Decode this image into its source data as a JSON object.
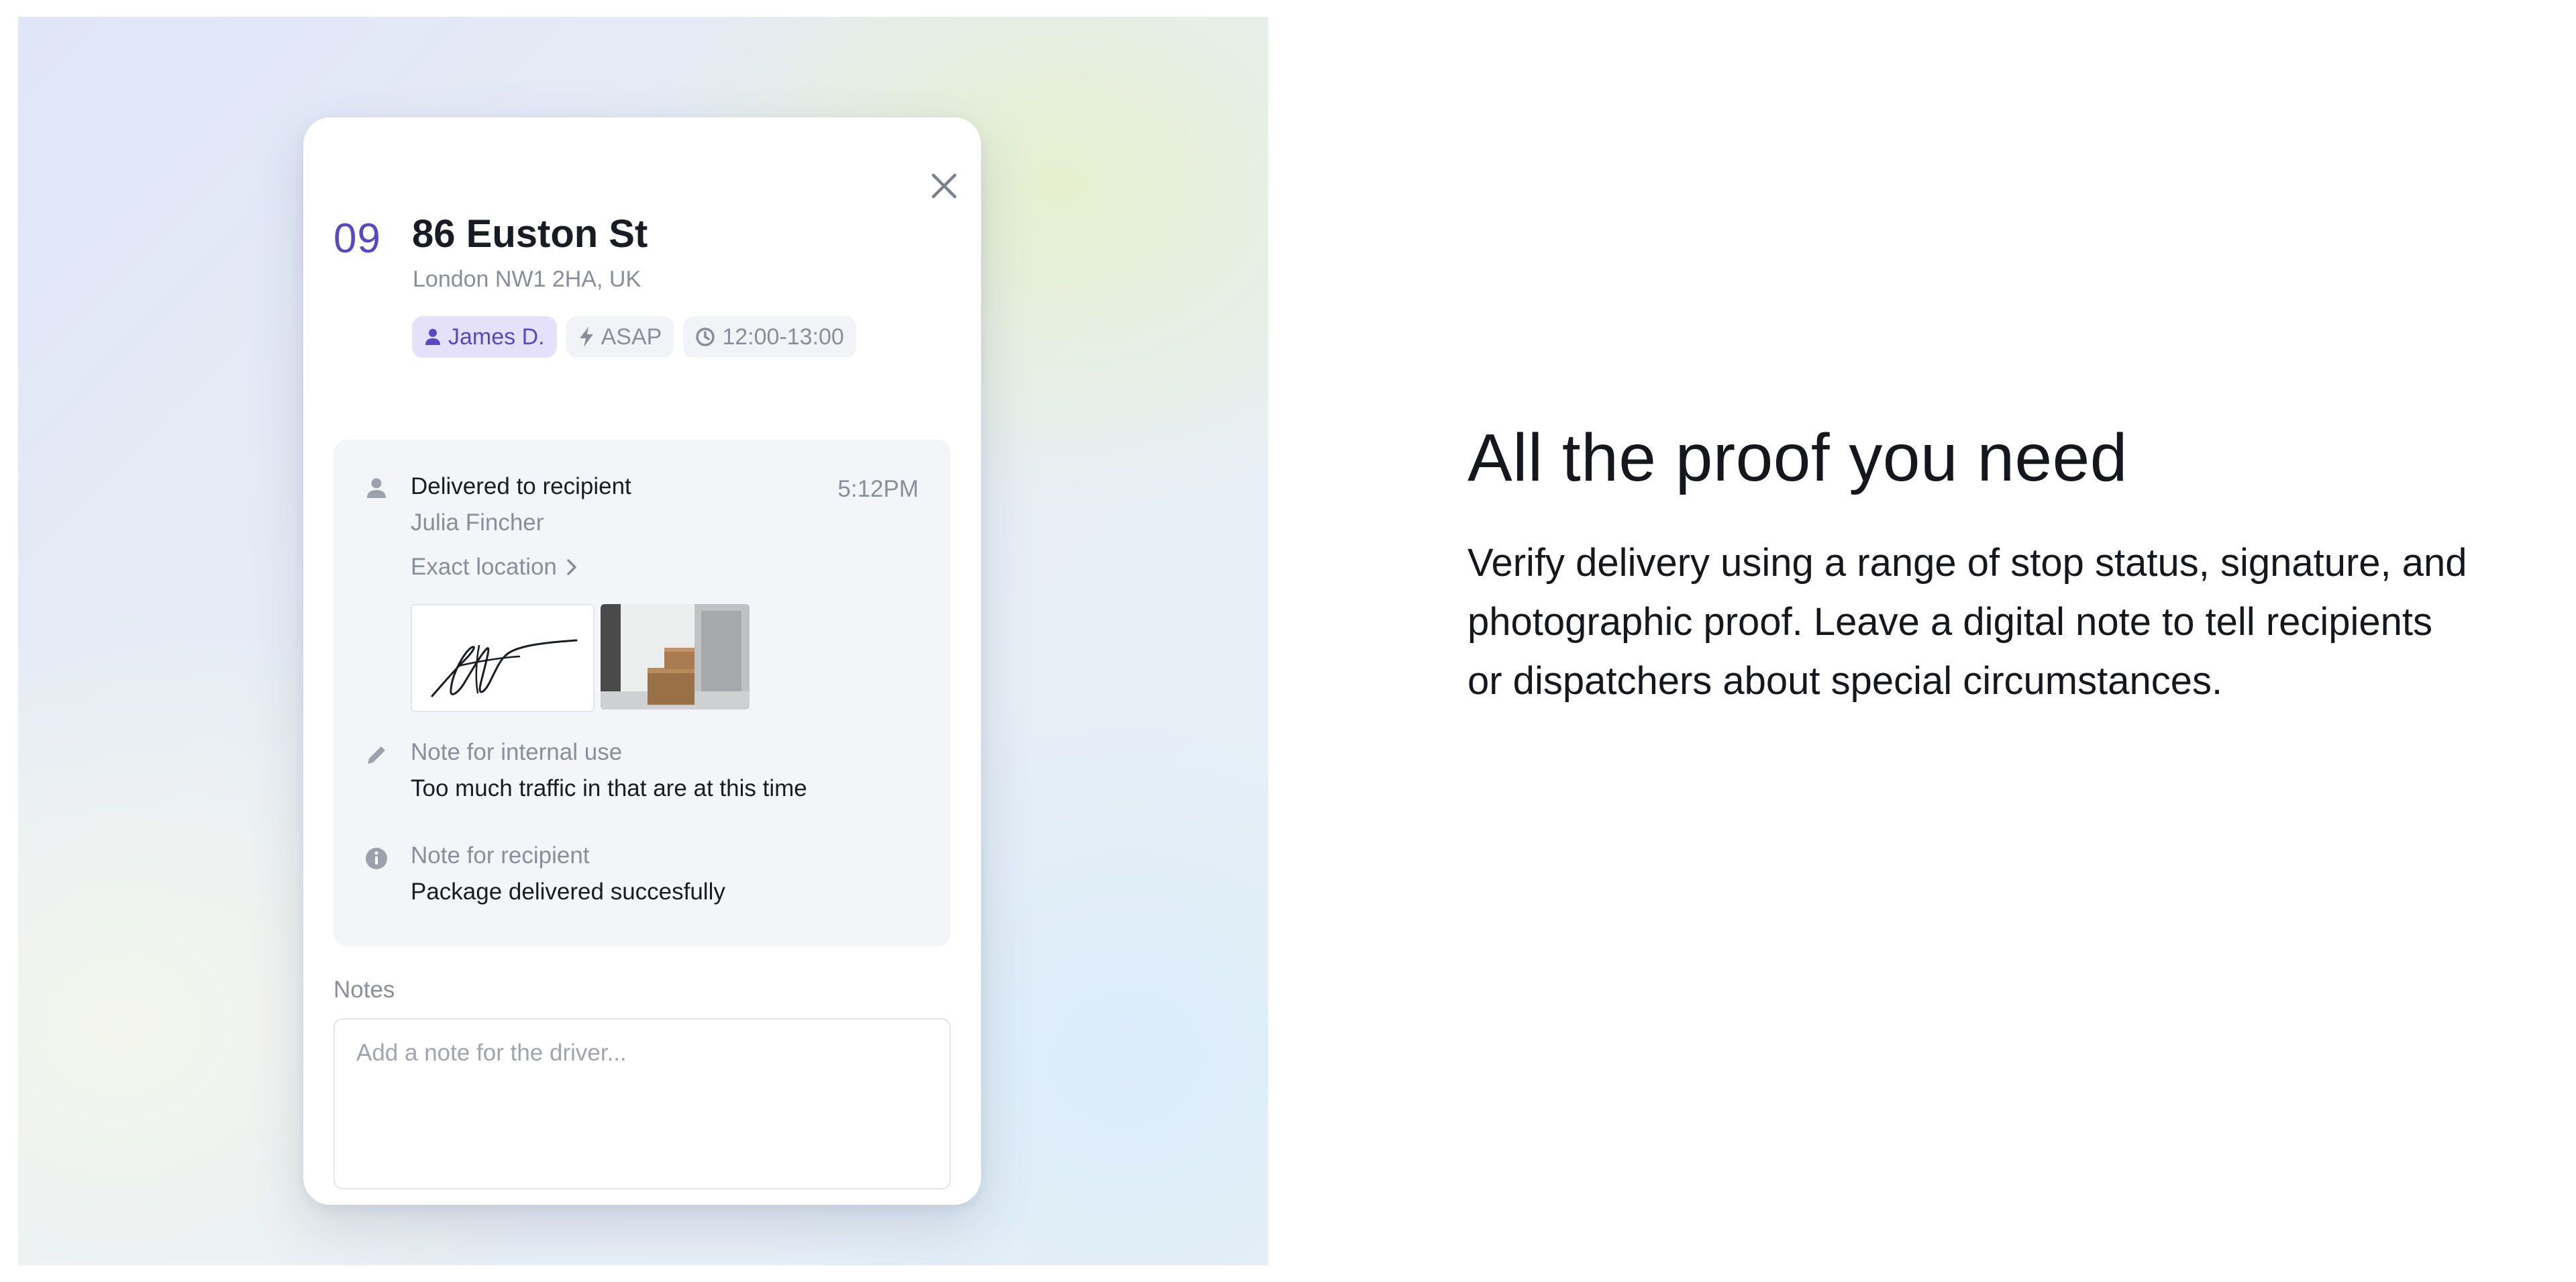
{
  "stop": {
    "number": "09",
    "address": "86 Euston St",
    "city": "London NW1 2HA, UK",
    "chips": {
      "driver": "James D.",
      "priority": "ASAP",
      "window": "12:00-13:00"
    }
  },
  "proof": {
    "status": "Delivered to recipient",
    "time": "5:12PM",
    "recipient": "Julia Fincher",
    "location_link": "Exact location",
    "internal_note_label": "Note for internal use",
    "internal_note": "Too much traffic in that are at this time",
    "recipient_note_label": "Note for recipient",
    "recipient_note": "Package delivered succesfully"
  },
  "notes": {
    "label": "Notes",
    "placeholder": "Add a note for the driver..."
  },
  "marketing": {
    "headline": "All the proof you need",
    "body": "Verify delivery using a range of stop status, signature, and photographic proof. Leave a digital note to tell recipients or dispatchers about special circumstances."
  },
  "colors": {
    "accent": "#5a48c2",
    "driver_chip_bg": "#e6e1fa",
    "muted_text": "#8a8e9a",
    "proof_panel_bg": "#f4f5f8"
  },
  "icons": {
    "close": "close-icon",
    "driver": "person-icon",
    "priority": "lightning-icon",
    "window": "clock-icon",
    "status": "person-icon",
    "location": "chevron-right-icon",
    "internal_note": "pencil-icon",
    "recipient_note": "info-icon"
  }
}
